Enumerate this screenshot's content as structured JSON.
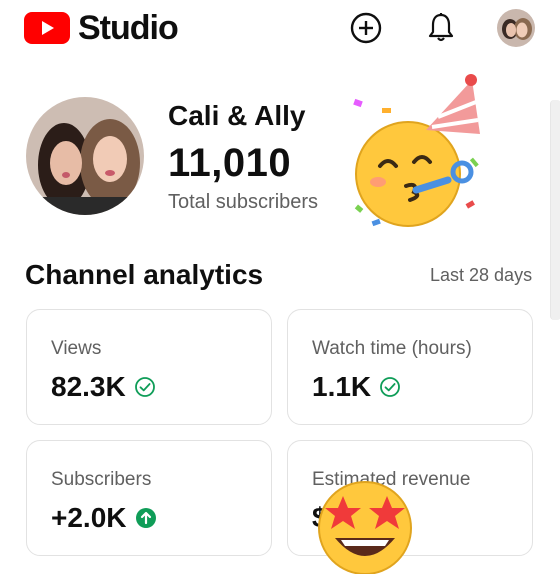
{
  "header": {
    "app_name": "Studio",
    "create_icon": "plus-circle-icon",
    "notification_icon": "bell-icon"
  },
  "channel": {
    "name": "Cali & Ally",
    "subscriber_count": "11,010",
    "subscriber_label": "Total subscribers"
  },
  "analytics": {
    "title": "Channel analytics",
    "period": "Last 28 days",
    "cards": [
      {
        "label": "Views",
        "value": "82.3K",
        "icon": "check-circle-icon"
      },
      {
        "label": "Watch time (hours)",
        "value": "1.1K",
        "icon": "check-circle-icon"
      },
      {
        "label": "Subscribers",
        "value": "+2.0K",
        "icon": "arrow-up-circle-icon"
      },
      {
        "label": "Estimated revenue",
        "value": "$",
        "icon": ""
      }
    ]
  },
  "colors": {
    "brand_red": "#ff0000",
    "check_green": "#0f9d58",
    "text_secondary": "#606060",
    "card_border": "#e2e2e2"
  }
}
